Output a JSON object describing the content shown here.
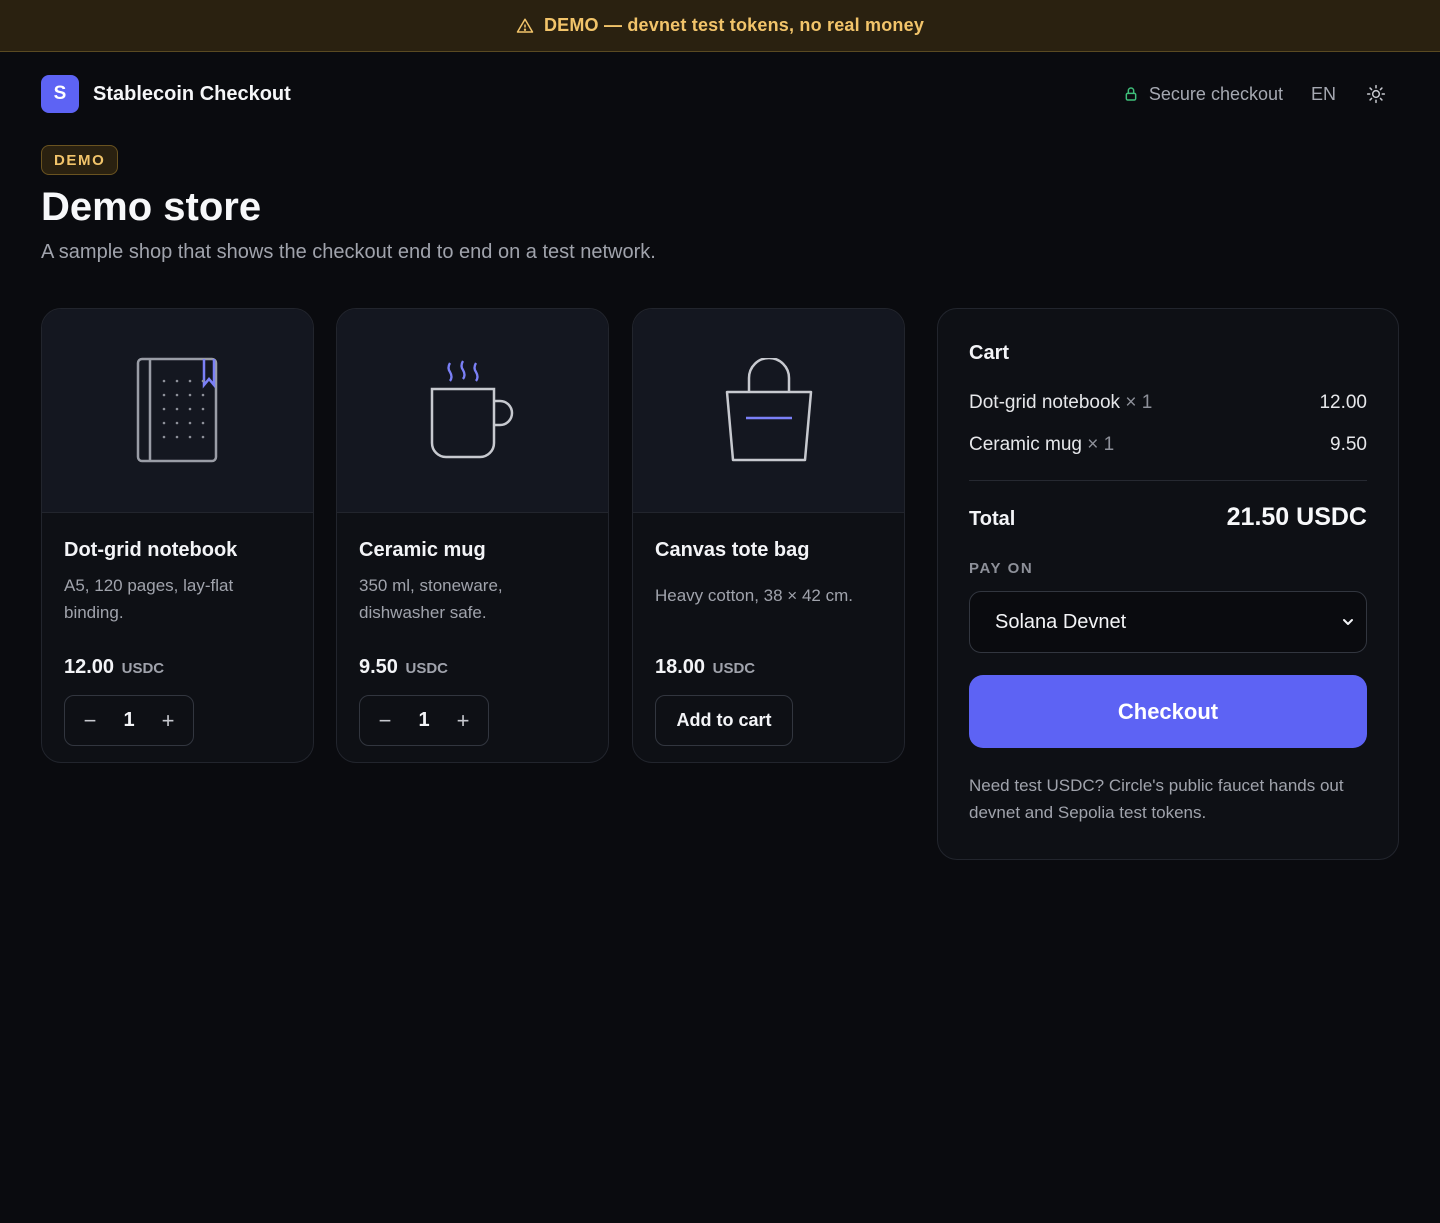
{
  "banner": {
    "text": "DEMO — devnet test tokens, no real money",
    "icon": "warning-icon"
  },
  "header": {
    "logo_letter": "S",
    "brand": "Stablecoin Checkout",
    "secure": "Secure checkout",
    "lang": "EN"
  },
  "page": {
    "badge": "DEMO",
    "title": "Demo store",
    "subtitle": "A sample shop that shows the checkout end to end on a test network."
  },
  "products": [
    {
      "name": "Dot-grid notebook",
      "desc": "A5, 120 pages, lay-flat binding.",
      "price": "12.00",
      "currency": "USDC",
      "qty": "1",
      "icon": "notebook-icon"
    },
    {
      "name": "Ceramic mug",
      "desc": "350 ml, stoneware, dishwasher safe.",
      "price": "9.50",
      "currency": "USDC",
      "qty": "1",
      "icon": "mug-icon"
    },
    {
      "name": "Canvas tote bag",
      "desc": "Heavy cotton, 38 × 42 cm.",
      "price": "18.00",
      "currency": "USDC",
      "add_label": "Add to cart",
      "icon": "tote-bag-icon"
    }
  ],
  "cart": {
    "title": "Cart",
    "lines": [
      {
        "name": "Dot-grid notebook",
        "qty": "× 1",
        "amount": "12.00"
      },
      {
        "name": "Ceramic mug",
        "qty": "× 1",
        "amount": "9.50"
      }
    ],
    "total_label": "Total",
    "total_value": "21.50 USDC",
    "pay_on_label": "PAY ON",
    "network": "Solana Devnet",
    "checkout_label": "Checkout",
    "note": "Need test USDC? Circle's public faucet hands out devnet and Sepolia test tokens."
  },
  "colors": {
    "accent": "#5d63f4",
    "warning": "#f2c46a",
    "background": "#0a0b0f"
  }
}
